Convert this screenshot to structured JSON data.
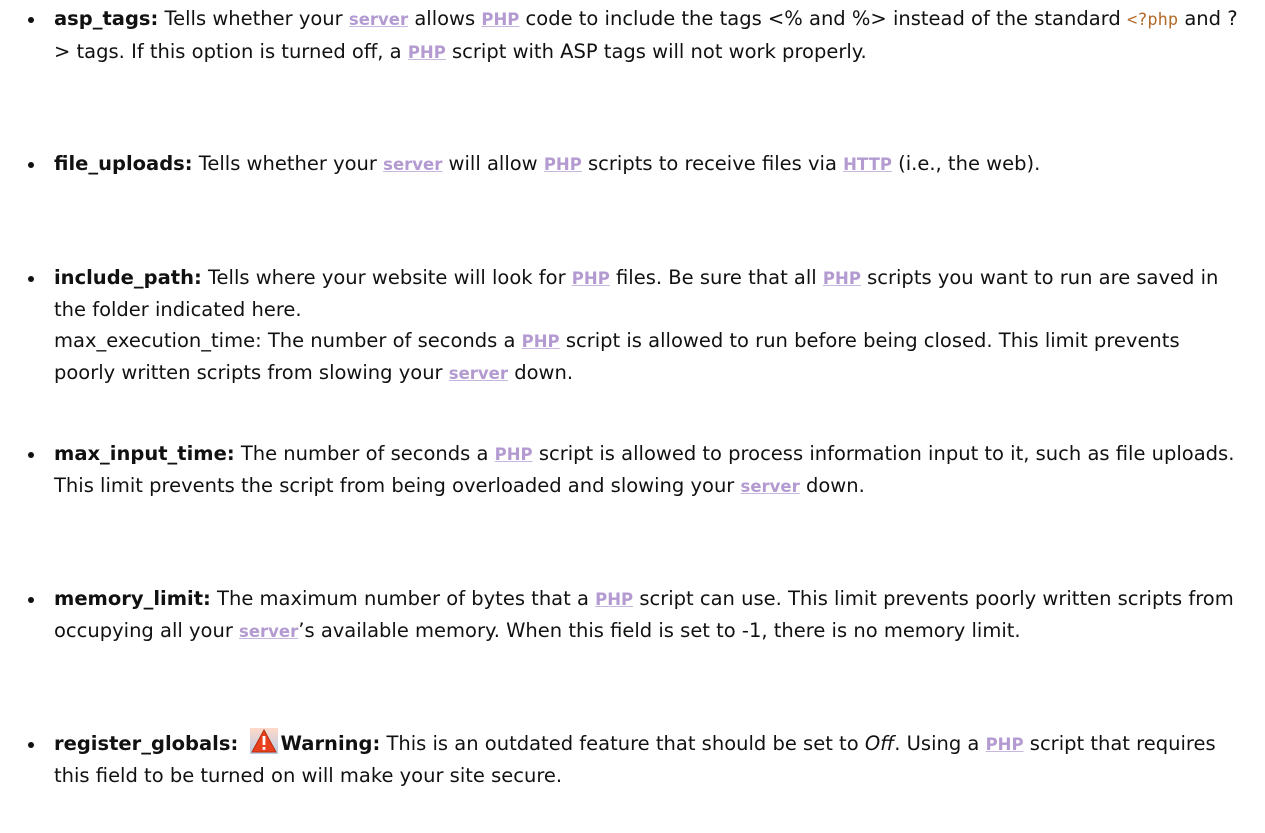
{
  "items": [
    {
      "term": "asp_tags:",
      "p1": " Tells whether your ",
      "link1": "server",
      "p2": " allows ",
      "link2": "PHP",
      "p3": " code to include the tags <% and %> instead of the standard ",
      "code": "<?php",
      "p4": " and ?> tags. If this option is turned off, a ",
      "link3": "PHP",
      "p5": " script with ASP tags will not work properly."
    },
    {
      "term": "file_uploads:",
      "p1": " Tells whether your ",
      "link1": "server",
      "p2": " will allow ",
      "link2": "PHP",
      "p3": " scripts to receive files via ",
      "link3": "HTTP",
      "p4": " (i.e., the web)."
    },
    {
      "term": "include_path:",
      "p1": " Tells where your website will look for ",
      "link1": "PHP",
      "p2": " files. Be sure that all ",
      "link2": "PHP",
      "p3": " scripts you want to run are saved in the folder indicated here.",
      "p4": "max_execution_time: The number of seconds a ",
      "link3": "PHP",
      "p5": " script is allowed to run before being closed. This limit prevents poorly written scripts from slowing your ",
      "link4": "server",
      "p6": " down."
    },
    {
      "term": "max_input_time:",
      "p1": " The number of seconds a ",
      "link1": "PHP",
      "p2": " script is allowed to process information input to it, such as file uploads. This limit prevents the script from being overloaded and slowing your ",
      "link2": "server",
      "p3": " down."
    },
    {
      "term": "memory_limit:",
      "p1": " The maximum number of bytes that a ",
      "link1": "PHP",
      "p2": " script can use. This limit prevents poorly written scripts from occupying all your ",
      "link2": "server",
      "p3": "’s available memory. When this field is set to -1, there is no memory limit."
    },
    {
      "term": "register_globals:",
      "warning_icon": "warning-triangle-icon",
      "warning_label": "Warning:",
      "p1": " This is an outdated feature that should be set to ",
      "em": "Off",
      "p2": ". Using a ",
      "link1": "PHP",
      "p3": " script that requires this field to be turned on will make your site secure."
    }
  ],
  "colors": {
    "link": "#b39ad1",
    "code": "#b36b2a",
    "warning": "#e8401c"
  }
}
